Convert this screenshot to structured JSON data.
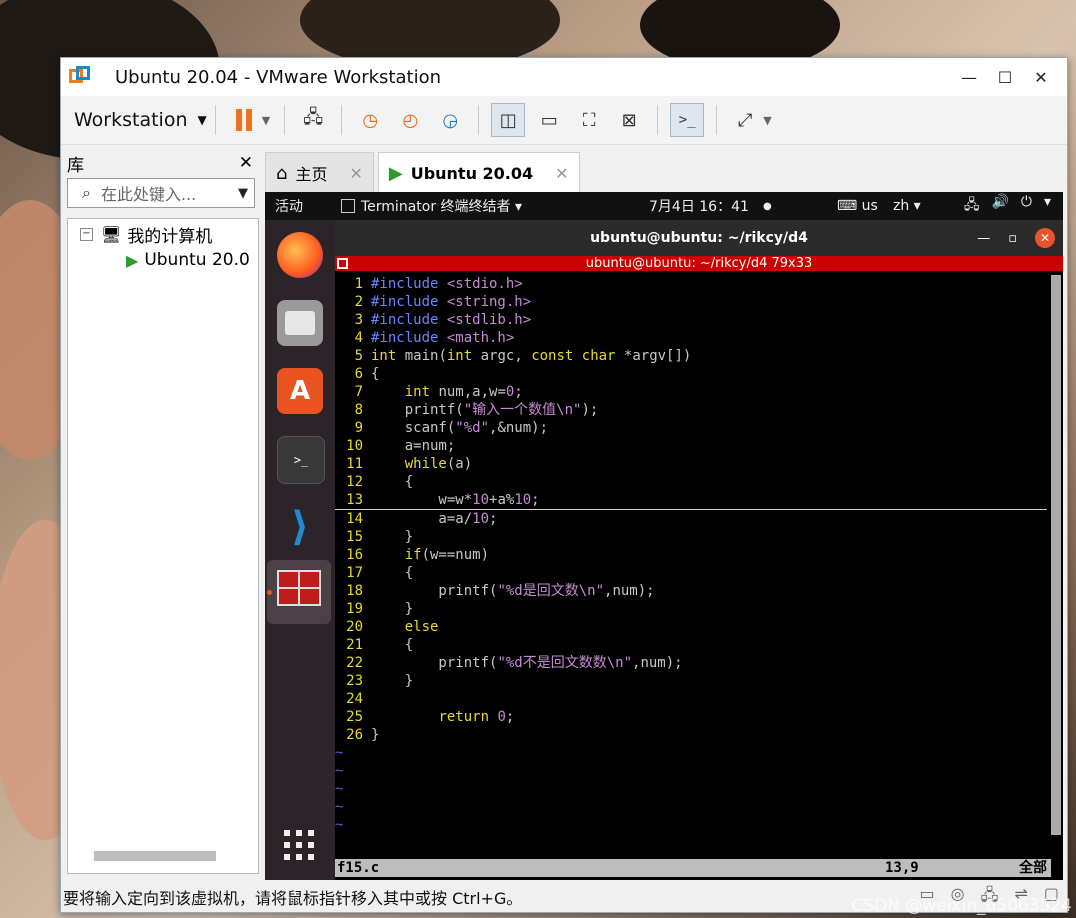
{
  "window": {
    "title": "Ubuntu 20.04 - VMware Workstation",
    "min": "—",
    "max": "☐",
    "close": "✕"
  },
  "toolbar": {
    "workstation_label": "Workstation"
  },
  "library": {
    "title": "库",
    "close": "✕",
    "search_placeholder": "在此处键入...",
    "tree": [
      {
        "label": "我的计算机"
      },
      {
        "label": "Ubuntu 20.0"
      }
    ]
  },
  "tabs": [
    {
      "label": "主页",
      "close": "✕"
    },
    {
      "label": "Ubuntu 20.04",
      "close": "✕"
    }
  ],
  "guest": {
    "activities": "活动",
    "app_name": "Terminator 终端终结者 ▾",
    "clock": "7月4日  16：41",
    "keyboard": "us",
    "lang": "zh ▾",
    "terminal_title": "ubuntu@ubuntu: ~/rikcy/d4",
    "terminal_bar": "ubuntu@ubuntu: ~/rikcy/d4 79x33",
    "status_file": "f15.c",
    "status_pos": "13,9",
    "status_all": "全部"
  },
  "code": [
    {
      "n": "1",
      "segs": [
        {
          "t": "#include ",
          "c": "pp"
        },
        {
          "t": "<stdio.h>",
          "c": "str"
        }
      ]
    },
    {
      "n": "2",
      "segs": [
        {
          "t": "#include ",
          "c": "pp"
        },
        {
          "t": "<string.h>",
          "c": "str"
        }
      ]
    },
    {
      "n": "3",
      "segs": [
        {
          "t": "#include ",
          "c": "pp"
        },
        {
          "t": "<stdlib.h>",
          "c": "str"
        }
      ]
    },
    {
      "n": "4",
      "segs": [
        {
          "t": "#include ",
          "c": "pp"
        },
        {
          "t": "<math.h>",
          "c": "str"
        }
      ]
    },
    {
      "n": "5",
      "segs": [
        {
          "t": "int",
          "c": "kw"
        },
        {
          "t": " main(",
          "c": ""
        },
        {
          "t": "int",
          "c": "kw"
        },
        {
          "t": " argc, ",
          "c": ""
        },
        {
          "t": "const char",
          "c": "kw"
        },
        {
          "t": " *argv[])",
          "c": ""
        }
      ]
    },
    {
      "n": "6",
      "segs": [
        {
          "t": "{",
          "c": ""
        }
      ]
    },
    {
      "n": "7",
      "segs": [
        {
          "t": "    ",
          "c": ""
        },
        {
          "t": "int",
          "c": "kw"
        },
        {
          "t": " num,a,w=",
          "c": ""
        },
        {
          "t": "0",
          "c": "num"
        },
        {
          "t": ";",
          "c": ""
        }
      ]
    },
    {
      "n": "8",
      "segs": [
        {
          "t": "    printf(",
          "c": ""
        },
        {
          "t": "\"输入一个数值\\n\"",
          "c": "str"
        },
        {
          "t": ");",
          "c": ""
        }
      ]
    },
    {
      "n": "9",
      "segs": [
        {
          "t": "    scanf(",
          "c": ""
        },
        {
          "t": "\"%d\"",
          "c": "str"
        },
        {
          "t": ",&num);",
          "c": ""
        }
      ]
    },
    {
      "n": "10",
      "segs": [
        {
          "t": "    a=num;",
          "c": ""
        }
      ]
    },
    {
      "n": "11",
      "segs": [
        {
          "t": "    ",
          "c": ""
        },
        {
          "t": "while",
          "c": "kw"
        },
        {
          "t": "(a)",
          "c": ""
        }
      ]
    },
    {
      "n": "12",
      "segs": [
        {
          "t": "    {",
          "c": ""
        }
      ]
    },
    {
      "n": "13",
      "cursor": true,
      "segs": [
        {
          "t": "        w=w*",
          "c": ""
        },
        {
          "t": "10",
          "c": "num"
        },
        {
          "t": "+a%",
          "c": ""
        },
        {
          "t": "10",
          "c": "num"
        },
        {
          "t": ";",
          "c": ""
        }
      ]
    },
    {
      "n": "14",
      "segs": [
        {
          "t": "        a=a/",
          "c": ""
        },
        {
          "t": "10",
          "c": "num"
        },
        {
          "t": ";",
          "c": ""
        }
      ]
    },
    {
      "n": "15",
      "segs": [
        {
          "t": "    }",
          "c": ""
        }
      ]
    },
    {
      "n": "16",
      "segs": [
        {
          "t": "    ",
          "c": ""
        },
        {
          "t": "if",
          "c": "kw"
        },
        {
          "t": "(w==num)",
          "c": ""
        }
      ]
    },
    {
      "n": "17",
      "segs": [
        {
          "t": "    {",
          "c": ""
        }
      ]
    },
    {
      "n": "18",
      "segs": [
        {
          "t": "        printf(",
          "c": ""
        },
        {
          "t": "\"%d是回文数\\n\"",
          "c": "str"
        },
        {
          "t": ",num);",
          "c": ""
        }
      ]
    },
    {
      "n": "19",
      "segs": [
        {
          "t": "    }",
          "c": ""
        }
      ]
    },
    {
      "n": "20",
      "segs": [
        {
          "t": "    ",
          "c": ""
        },
        {
          "t": "else",
          "c": "kw"
        }
      ]
    },
    {
      "n": "21",
      "segs": [
        {
          "t": "    {",
          "c": ""
        }
      ]
    },
    {
      "n": "22",
      "segs": [
        {
          "t": "        printf(",
          "c": ""
        },
        {
          "t": "\"%d不是回文数数\\n\"",
          "c": "str"
        },
        {
          "t": ",num);",
          "c": ""
        }
      ]
    },
    {
      "n": "23",
      "segs": [
        {
          "t": "    }",
          "c": ""
        }
      ]
    },
    {
      "n": "24",
      "segs": []
    },
    {
      "n": "25",
      "segs": [
        {
          "t": "        ",
          "c": ""
        },
        {
          "t": "return",
          "c": "kw"
        },
        {
          "t": " ",
          "c": ""
        },
        {
          "t": "0",
          "c": "num"
        },
        {
          "t": ";",
          "c": ""
        }
      ]
    },
    {
      "n": "26",
      "segs": [
        {
          "t": "}",
          "c": ""
        }
      ]
    },
    {
      "n": "~",
      "tilde": true,
      "segs": []
    },
    {
      "n": "~",
      "tilde": true,
      "segs": []
    },
    {
      "n": "~",
      "tilde": true,
      "segs": []
    },
    {
      "n": "~",
      "tilde": true,
      "segs": []
    },
    {
      "n": "~",
      "tilde": true,
      "segs": []
    }
  ],
  "statusbar": {
    "message": "要将输入定向到该虚拟机，请将鼠标指针移入其中或按 Ctrl+G。"
  },
  "watermark": "CSDN @weixin_65063524"
}
